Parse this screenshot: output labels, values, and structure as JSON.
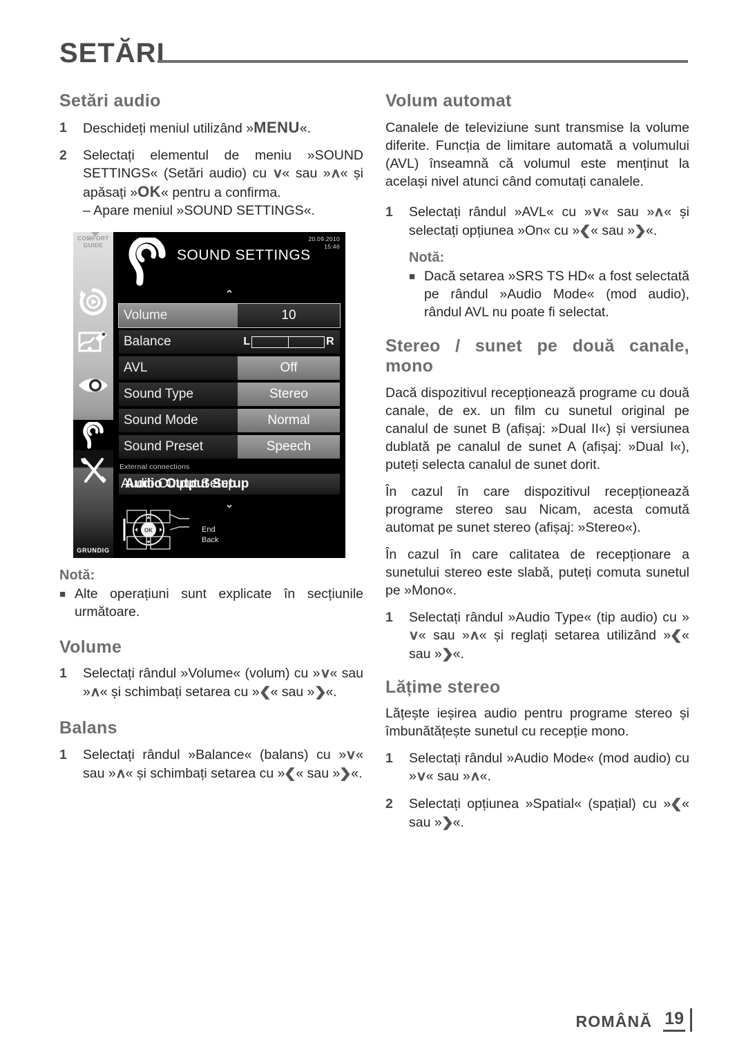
{
  "header": {
    "title": "SETĂRI"
  },
  "left_column": {
    "heading": "Setări audio",
    "steps": [
      {
        "num": "1",
        "parts": [
          {
            "t": "Deschideți meniul utilizând »",
            "s": "plain"
          },
          {
            "t": "MENU",
            "s": "kbd"
          },
          {
            "t": "«.",
            "s": "plain"
          }
        ]
      },
      {
        "num": "2",
        "parts": [
          {
            "t": "Selectați elementul de meniu »SOUND SETTINGS« (Setări audio) cu ",
            "s": "plain"
          },
          {
            "t": "∨",
            "s": "arrow"
          },
          {
            "t": "« sau »",
            "s": "plain"
          },
          {
            "t": "∧",
            "s": "arrow"
          },
          {
            "t": "« și apăsați »",
            "s": "plain"
          },
          {
            "t": "OK",
            "s": "kbd"
          },
          {
            "t": "« pentru a confirma.",
            "s": "plain"
          }
        ],
        "sub": "– Apare meniul »SOUND SETTINGS«."
      }
    ],
    "note_label": "Notă:",
    "note_bullets": [
      "Alte operațiuni sunt explicate în secțiunile următoare."
    ],
    "volume_heading": "Volume",
    "volume_step": {
      "num": "1",
      "parts": [
        {
          "t": "Selectați rândul »Volume« (volum) cu »",
          "s": "plain"
        },
        {
          "t": "∨",
          "s": "arrow"
        },
        {
          "t": "« sau »",
          "s": "plain"
        },
        {
          "t": "∧",
          "s": "arrow"
        },
        {
          "t": "« și schimbați setarea cu »",
          "s": "plain"
        },
        {
          "t": "❮",
          "s": "arrow"
        },
        {
          "t": "« sau »",
          "s": "plain"
        },
        {
          "t": "❯",
          "s": "arrow"
        },
        {
          "t": "«.",
          "s": "plain"
        }
      ]
    },
    "balance_heading": "Balans",
    "balance_step": {
      "num": "1",
      "parts": [
        {
          "t": "Selectați rândul »Balance« (balans) cu »",
          "s": "plain"
        },
        {
          "t": "∨",
          "s": "arrow"
        },
        {
          "t": "« sau »",
          "s": "plain"
        },
        {
          "t": "∧",
          "s": "arrow"
        },
        {
          "t": "« și schimbați setarea cu »",
          "s": "plain"
        },
        {
          "t": "❮",
          "s": "arrow"
        },
        {
          "t": "« sau »",
          "s": "plain"
        },
        {
          "t": "❯",
          "s": "arrow"
        },
        {
          "t": "«.",
          "s": "plain"
        }
      ]
    }
  },
  "tv_screenshot": {
    "comfort_guide": "COMFORT\nGUIDE",
    "comfort_guide_line1": "COMFORT",
    "comfort_guide_line2": "GUIDE",
    "brand": "GRUNDIG",
    "menu_title": "SOUND SETTINGS",
    "date": "20.09.2010",
    "time": "15:46",
    "rows": [
      {
        "label": "Volume",
        "value": "10",
        "style": "selected"
      },
      {
        "label": "Balance",
        "value": "",
        "style": "balance",
        "left_mark": "L",
        "right_mark": "R"
      },
      {
        "label": "AVL",
        "value": "Off",
        "style": "value-light"
      },
      {
        "label": "Sound Type",
        "value": "Stereo",
        "style": "value-light"
      },
      {
        "label": "Sound Mode",
        "value": "Normal",
        "style": "value-light"
      },
      {
        "label": "Sound Preset",
        "value": "Speech",
        "style": "value-light"
      }
    ],
    "section_label": "External connections",
    "submenu_item": "Audio Output Setup",
    "submenu_item_overlay": "Audio Output Setup",
    "hint_end": "End",
    "hint_back": "Back",
    "ok_label": "OK",
    "sidebar_icons": [
      "timeshift-icon",
      "image-settings-icon",
      "eye-icon",
      "ear-icon",
      "tools-icon"
    ]
  },
  "right_column": {
    "avl_heading": "Volum automat",
    "avl_paragraph": "Canalele de televiziune sunt transmise la volume diferite. Funcția de limitare automată a volumului (AVL) înseamnă că volumul este menținut la același nivel atunci când comutați canalele.",
    "avl_step": {
      "num": "1",
      "parts": [
        {
          "t": "Selectați rândul »AVL« cu »",
          "s": "plain"
        },
        {
          "t": "∨",
          "s": "arrow"
        },
        {
          "t": "« sau »",
          "s": "plain"
        },
        {
          "t": "∧",
          "s": "arrow"
        },
        {
          "t": "« și selectați opțiunea »On« cu »",
          "s": "plain"
        },
        {
          "t": "❮",
          "s": "arrow"
        },
        {
          "t": "« sau »",
          "s": "plain"
        },
        {
          "t": "❯",
          "s": "arrow"
        },
        {
          "t": "«.",
          "s": "plain"
        }
      ]
    },
    "note_label": "Notă:",
    "note_bullets": [
      "Dacă setarea »SRS TS HD« a fost selectată pe rândul »Audio Mode« (mod audio), rândul AVL nu poate fi selectat."
    ],
    "stereo_heading": "Stereo / sunet pe două canale, mono",
    "stereo_paragraphs": [
      "Dacă dispozitivul recepționează programe cu două canale, de ex. un film cu sunetul original pe canalul de sunet B (afișaj: »Dual II«) și versiunea dublată pe canalul de sunet A (afișaj: »Dual I«), puteți selecta canalul de sunet dorit.",
      "În cazul în care dispozitivul recepționează programe stereo sau Nicam, acesta comută automat pe sunet stereo (afișaj: »Stereo«).",
      "În cazul în care calitatea de recepționare a sunetului stereo este slabă, puteți comuta sunetul pe »Mono«."
    ],
    "stereo_step": {
      "num": "1",
      "parts": [
        {
          "t": "Selectați rândul »Audio Type« (tip audio) cu »",
          "s": "plain"
        },
        {
          "t": "∨",
          "s": "arrow"
        },
        {
          "t": "« sau »",
          "s": "plain"
        },
        {
          "t": "∧",
          "s": "arrow"
        },
        {
          "t": "« și reglați setarea utilizând »",
          "s": "plain"
        },
        {
          "t": "❮",
          "s": "arrow"
        },
        {
          "t": "« sau »",
          "s": "plain"
        },
        {
          "t": "❯",
          "s": "arrow"
        },
        {
          "t": "«.",
          "s": "plain"
        }
      ]
    },
    "width_heading": "Lățime stereo",
    "width_paragraph": "Lățește ieșirea audio pentru programe stereo și îmbunătățește sunetul cu recepție mono.",
    "width_steps": [
      {
        "num": "1",
        "parts": [
          {
            "t": "Selectați rândul »Audio Mode« (mod audio) cu »",
            "s": "plain"
          },
          {
            "t": "∨",
            "s": "arrow"
          },
          {
            "t": "« sau »",
            "s": "plain"
          },
          {
            "t": "∧",
            "s": "arrow"
          },
          {
            "t": "«.",
            "s": "plain"
          }
        ]
      },
      {
        "num": "2",
        "parts": [
          {
            "t": "Selectați opțiunea »Spatial« (spațial) cu »",
            "s": "plain"
          },
          {
            "t": "❮",
            "s": "arrow"
          },
          {
            "t": "« sau »",
            "s": "plain"
          },
          {
            "t": "❯",
            "s": "arrow"
          },
          {
            "t": "«.",
            "s": "plain"
          }
        ]
      }
    ]
  },
  "footer": {
    "language": "ROMÂNĂ",
    "page": "19"
  },
  "colors": {
    "heading": "#6d6d6d",
    "body": "#262626",
    "rule": "#6e6e6e"
  }
}
